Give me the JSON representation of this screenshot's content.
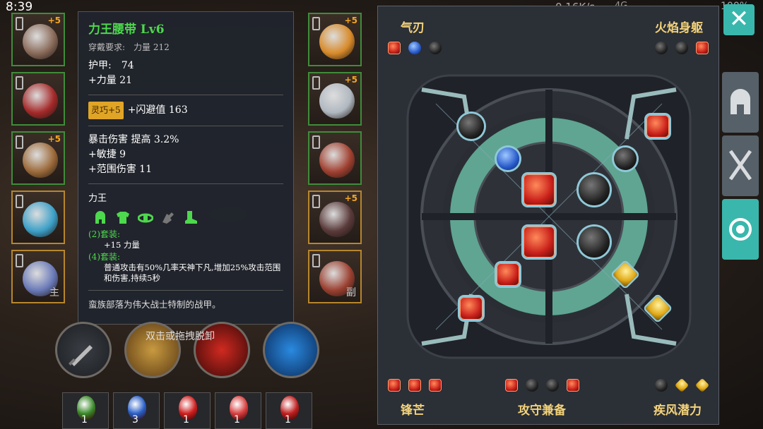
{
  "status_bar": {
    "time": "8:39",
    "network": "0.16K/s",
    "signal": "4G",
    "battery": "100%"
  },
  "equipment_left": [
    {
      "name": "helmet",
      "plus": "+5",
      "mark": "",
      "color": "#8a6b5a"
    },
    {
      "name": "chest",
      "plus": "",
      "mark": "",
      "color": "#a52a2a"
    },
    {
      "name": "belt",
      "plus": "+5",
      "mark": "",
      "color": "#9c6a3a"
    },
    {
      "name": "ring",
      "plus": "",
      "mark": "",
      "color": "#3da0c8"
    },
    {
      "name": "main-weapon",
      "plus": "",
      "mark": "主",
      "color": "#6a7ab8"
    }
  ],
  "equipment_right": [
    {
      "name": "amulet",
      "plus": "+5",
      "mark": "",
      "color": "#d88a2a"
    },
    {
      "name": "gloves",
      "plus": "+5",
      "mark": "",
      "color": "#b0b8c0"
    },
    {
      "name": "boots",
      "plus": "",
      "mark": "",
      "color": "#a04030"
    },
    {
      "name": "ring",
      "plus": "+5",
      "mark": "",
      "color": "#5a3a3a"
    },
    {
      "name": "off-weapon",
      "plus": "",
      "mark": "副",
      "color": "#9a4030"
    }
  ],
  "tooltip": {
    "title": "力王腰带 Lv6",
    "requirement": "穿戴要求:　力量 212",
    "armor": "护甲:　74",
    "strength": "+力量 21",
    "badge": "灵巧+5",
    "dodge": "+闪避值 163",
    "crit": "暴击伤害 提高 3.2%",
    "agility": "+敏捷 9",
    "range_damage": "+范围伤害 11",
    "set_name": "力王",
    "set2_label": "(2)套装:",
    "set2_effect": "+15 力量",
    "set4_label": "(4)套装:",
    "set4_effect": "普通攻击有50%几率天神下凡,增加25%攻击范围和伤害,持续5秒",
    "flavor": "蛮族部落为伟大战士特制的战甲。"
  },
  "set_icons": [
    "helmet-set-icon",
    "chest-set-icon",
    "belt-set-icon",
    "gloves-set-icon",
    "boots-set-icon"
  ],
  "drag_tip": "双击或拖拽脱卸",
  "rune_panel": {
    "top_left": {
      "title": "气刃",
      "gems": [
        "red",
        "blue",
        "dark"
      ]
    },
    "top_right": {
      "title": "火焰身躯",
      "gems": [
        "dark",
        "dark",
        "red"
      ]
    },
    "bottom_left": {
      "title": "锋芒",
      "gems": [
        "red",
        "red",
        "red"
      ]
    },
    "bottom_center": {
      "title": "攻守兼备",
      "gems": [
        "red",
        "dark",
        "dark",
        "red"
      ]
    },
    "bottom_right": {
      "title": "疾风潜力",
      "gems": [
        "dark",
        "gold",
        "gold"
      ]
    }
  },
  "tabs": [
    "helmet-tab",
    "weapon-tab",
    "rune-tab"
  ],
  "potions": [
    {
      "count": "1",
      "color": "#3a8a2a"
    },
    {
      "count": "3",
      "color": "#2a60c8"
    },
    {
      "count": "1",
      "color": "#d02020"
    },
    {
      "count": "1",
      "color": "#d84040"
    },
    {
      "count": "1",
      "color": "#c02020"
    }
  ]
}
